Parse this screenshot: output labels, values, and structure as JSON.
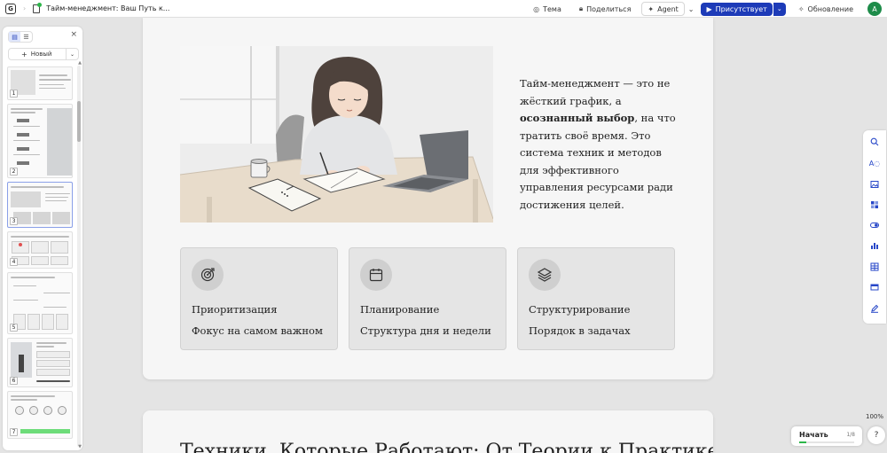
{
  "topbar": {
    "logo": "G",
    "doc_title": "Тайм-менеджмент: Ваш Путь к...",
    "theme_label": "Тема",
    "share_label": "Поделиться",
    "agent_label": "Agent",
    "present_label": "Присутствует",
    "update_label": "Обновление",
    "avatar_letter": "A",
    "accent_color": "#1d3bb8"
  },
  "sidebar": {
    "new_label": "Новый",
    "slides": [
      {
        "number": "1"
      },
      {
        "number": "2"
      },
      {
        "number": "3"
      },
      {
        "number": "4"
      },
      {
        "number": "5"
      },
      {
        "number": "6"
      },
      {
        "number": "7"
      }
    ]
  },
  "slide": {
    "intro_part1": "Тайм-менеджмент — это не жёсткий график, а ",
    "intro_bold": "осознанный выбор",
    "intro_part2": ", на что тратить своё время. Это система техник и методов для эффективного управления ресурсами ради достижения целей.",
    "features": [
      {
        "icon": "target-icon",
        "title": "Приоритизация",
        "desc": "Фокус на самом важном"
      },
      {
        "icon": "calendar-icon",
        "title": "Планирование",
        "desc": "Структура дня и недели"
      },
      {
        "icon": "layers-icon",
        "title": "Структурирование",
        "desc": "Порядок в задачах"
      }
    ]
  },
  "next_slide": {
    "heading": "Техники, Которые Работают: От Теории к Практике"
  },
  "right_tools": [
    "search-icon",
    "text-style-icon",
    "image-icon",
    "layout-icon",
    "toggle-icon",
    "chart-icon",
    "table-icon",
    "card-icon",
    "edit-icon"
  ],
  "footer": {
    "zoom": "100%",
    "start_label": "Начать",
    "progress": "1/8",
    "progress_fraction": 0.125,
    "help_label": "?"
  }
}
